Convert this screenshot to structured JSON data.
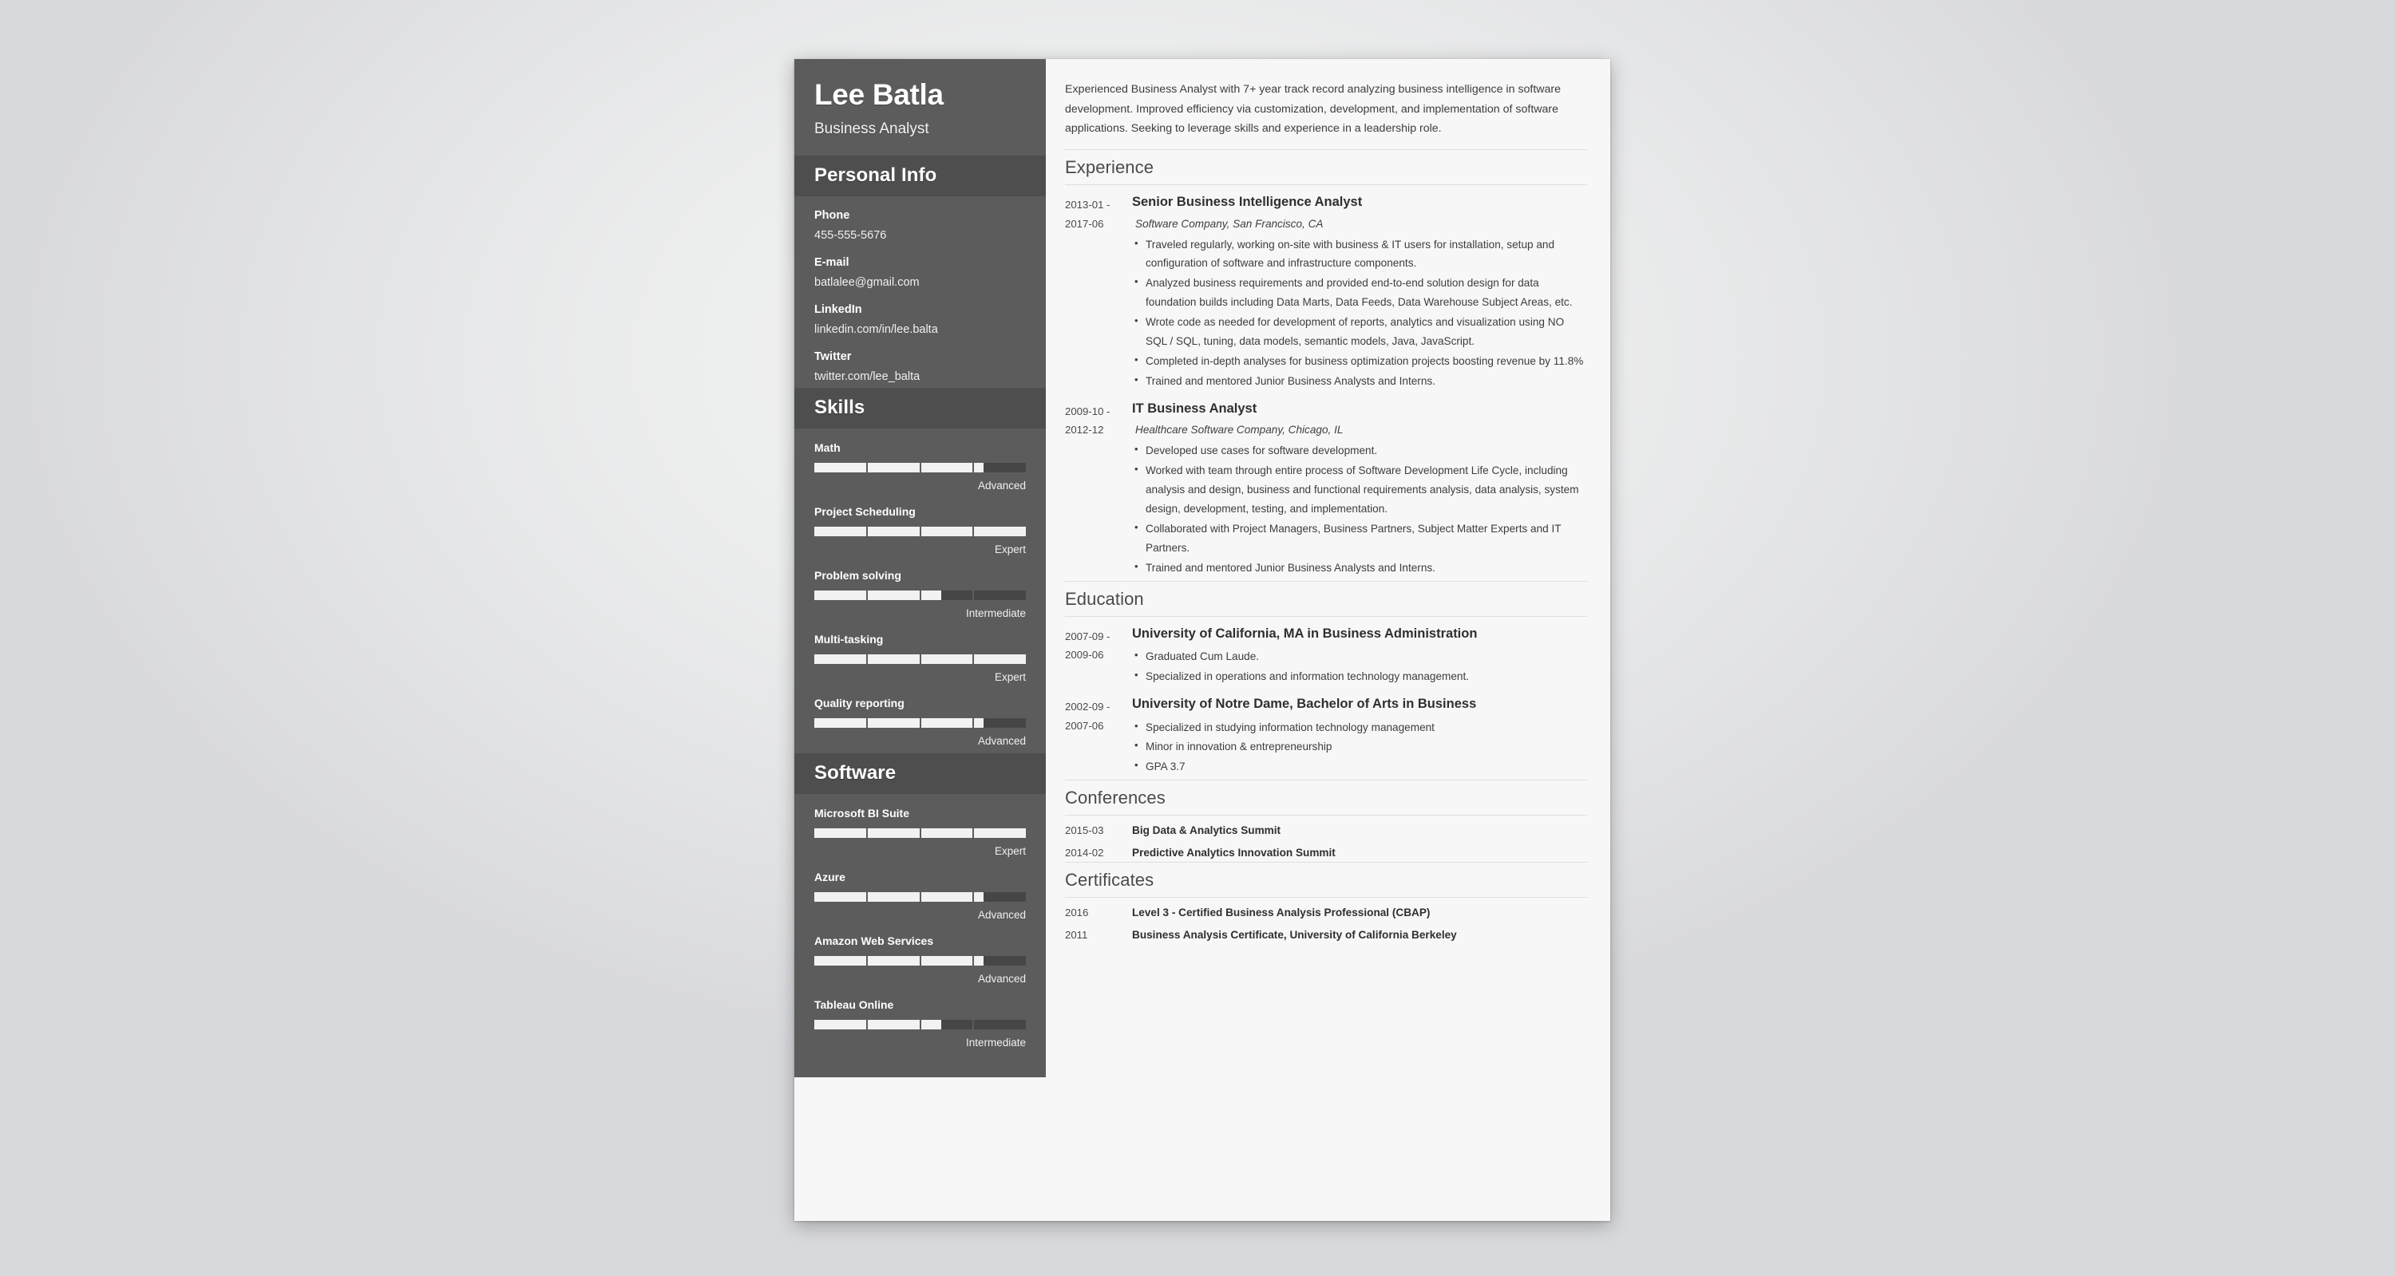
{
  "theme": {
    "sidebar_bg": "#5c5c5c",
    "sidebar_band_bg": "#4e4e4e",
    "page_bg": "#f7f7f7",
    "bar_fill": "#f2f2f2",
    "bar_track": "#464646",
    "text_dark": "#3a3a3a"
  },
  "sidebar": {
    "name": "Lee Batla",
    "job_title": "Business Analyst",
    "personal_info": {
      "heading": "Personal Info",
      "items": [
        {
          "label": "Phone",
          "value": "455-555-5676"
        },
        {
          "label": "E-mail",
          "value": "batlalee@gmail.com"
        },
        {
          "label": "LinkedIn",
          "value": "linkedin.com/in/lee.balta"
        },
        {
          "label": "Twitter",
          "value": "twitter.com/lee_balta"
        }
      ]
    },
    "skills": {
      "heading": "Skills",
      "items": [
        {
          "label": "Math",
          "level": "Advanced",
          "percent": 80
        },
        {
          "label": "Project Scheduling",
          "level": "Expert",
          "percent": 100
        },
        {
          "label": "Problem solving",
          "level": "Intermediate",
          "percent": 60
        },
        {
          "label": "Multi-tasking",
          "level": "Expert",
          "percent": 100
        },
        {
          "label": "Quality reporting",
          "level": "Advanced",
          "percent": 80
        }
      ]
    },
    "software": {
      "heading": "Software",
      "items": [
        {
          "label": "Microsoft BI Suite",
          "level": "Expert",
          "percent": 100
        },
        {
          "label": "Azure",
          "level": "Advanced",
          "percent": 80
        },
        {
          "label": "Amazon Web Services",
          "level": "Advanced",
          "percent": 80
        },
        {
          "label": "Tableau Online",
          "level": "Intermediate",
          "percent": 60
        }
      ]
    }
  },
  "main": {
    "summary": "Experienced Business Analyst with 7+ year track record analyzing business intelligence in software development. Improved efficiency via customization, development, and implementation of software applications. Seeking to leverage skills and experience in a leadership role.",
    "experience": {
      "heading": "Experience",
      "entries": [
        {
          "date": "2013-01 - 2017-06",
          "date_start": "2013-01 -",
          "date_end": "2017-06",
          "title": "Senior Business Intelligence Analyst",
          "company": "Software Company, San Francisco, CA",
          "bullets": [
            "Traveled regularly, working on-site with business & IT users for installation, setup and configuration of software and infrastructure components.",
            "Analyzed business requirements and provided end-to-end solution design for data foundation builds including Data Marts, Data Feeds, Data Warehouse Subject Areas, etc.",
            "Wrote code as needed for development of reports, analytics and visualization using NO SQL / SQL, tuning, data models, semantic models, Java, JavaScript.",
            "Completed in-depth analyses for business optimization projects boosting revenue by 11.8%",
            "Trained and mentored Junior Business Analysts and Interns."
          ]
        },
        {
          "date": "2009-10 - 2012-12",
          "date_start": "2009-10 -",
          "date_end": "2012-12",
          "title": "IT Business Analyst",
          "company": "Healthcare Software Company, Chicago, IL",
          "bullets": [
            "Developed use cases for software development.",
            "Worked with team through entire process of Software Development Life Cycle, including analysis and design, business and functional requirements analysis, data analysis, system design, development, testing, and implementation.",
            "Collaborated with Project Managers, Business Partners, Subject Matter Experts and IT Partners.",
            "Trained and mentored Junior Business Analysts and Interns."
          ]
        }
      ]
    },
    "education": {
      "heading": "Education",
      "entries": [
        {
          "date_start": "2007-09 -",
          "date_end": "2009-06",
          "title": "University of California, MA in Business Administration",
          "bullets": [
            "Graduated Cum Laude.",
            "Specialized in operations and information technology management."
          ]
        },
        {
          "date_start": "2002-09 -",
          "date_end": "2007-06",
          "title": "University of Notre Dame, Bachelor of Arts in Business",
          "bullets": [
            "Specialized in studying information technology management",
            "Minor in innovation & entrepreneurship",
            "GPA 3.7"
          ]
        }
      ]
    },
    "conferences": {
      "heading": "Conferences",
      "entries": [
        {
          "date": "2015-03",
          "title": "Big Data & Analytics Summit"
        },
        {
          "date": "2014-02",
          "title": "Predictive Analytics Innovation Summit"
        }
      ]
    },
    "certificates": {
      "heading": "Certificates",
      "entries": [
        {
          "date": "2016",
          "title": "Level 3 - Certified Business Analysis Professional (CBAP)"
        },
        {
          "date": "2011",
          "title": "Business Analysis Certificate, University of California Berkeley"
        }
      ]
    }
  }
}
